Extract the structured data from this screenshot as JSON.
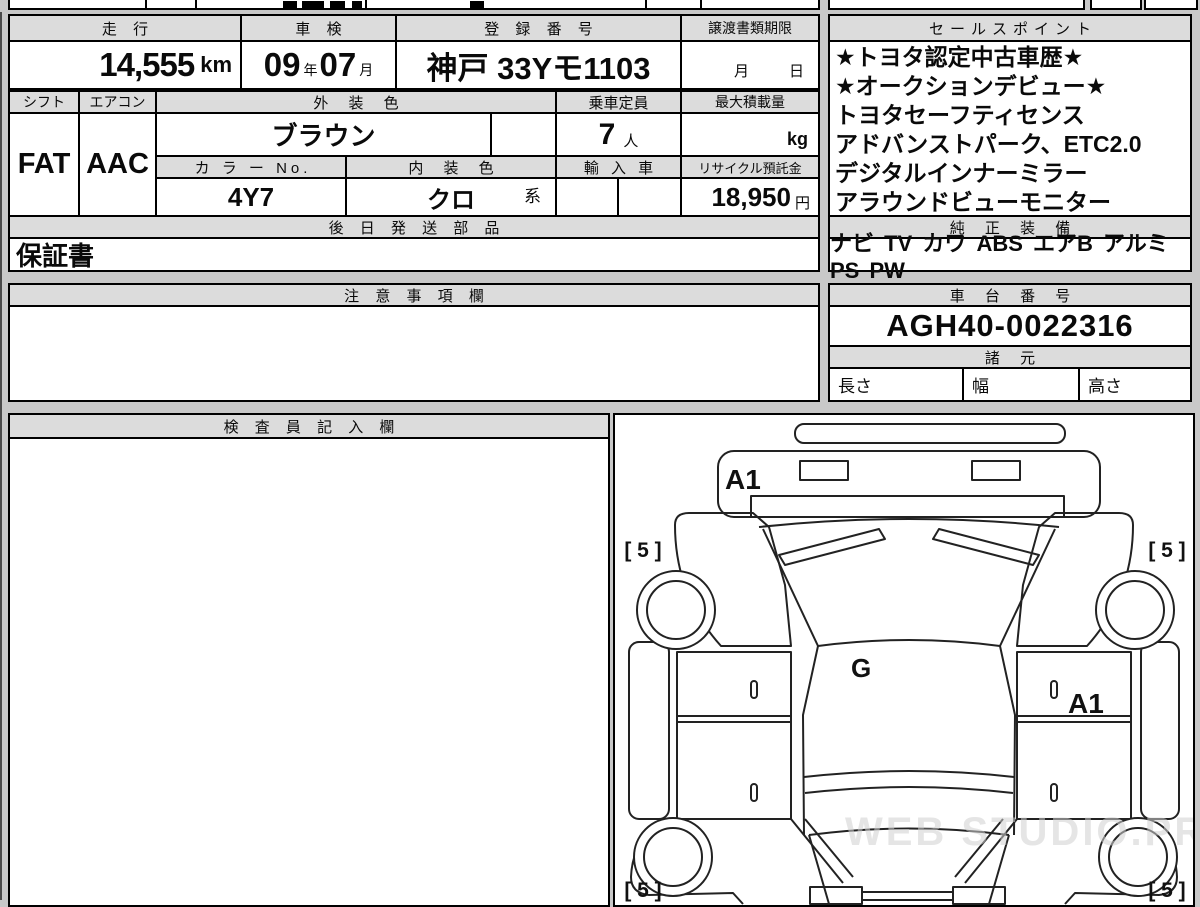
{
  "top_table": {
    "mileage": {
      "header": "走 行",
      "value": "14,555",
      "unit": "km"
    },
    "inspection": {
      "header": "車 検",
      "year": "09",
      "year_unit": "年",
      "month": "07",
      "month_unit": "月"
    },
    "registration": {
      "header": "登 録 番 号",
      "value": "神戸 33Yモ1103"
    },
    "transfer_deadline": {
      "header": "譲渡書類期限",
      "month_label": "月",
      "day_label": "日"
    }
  },
  "spec_table": {
    "shift": {
      "header": "シフト",
      "value": "FAT"
    },
    "aircon": {
      "header": "エアコン",
      "value": "AAC"
    },
    "exterior_color": {
      "header": "外 装 色",
      "value": "ブラウン"
    },
    "capacity": {
      "header": "乗車定員",
      "value": "7",
      "unit": "人"
    },
    "max_load": {
      "header": "最大積載量",
      "unit": "kg"
    },
    "color_no": {
      "header": "カ ラ ー No.",
      "value": "4Y7"
    },
    "interior_color": {
      "header": "内 装 色",
      "value": "クロ",
      "suffix": "系"
    },
    "import_car": {
      "header": "輸 入 車"
    },
    "recycle": {
      "header": "リサイクル預託金",
      "value": "18,950",
      "unit": "円"
    }
  },
  "later_parts": {
    "header": "後 日 発 送 部 品",
    "value": "保証書"
  },
  "sales_points": {
    "header": "セールスポイント",
    "items": [
      "★トヨタ認定中古車歴★",
      "★オークションデビュー★",
      "トヨタセーフティセンス",
      "アドバンストパーク、ETC2.0",
      "デジタルインナーミラー",
      "アラウンドビューモニター"
    ]
  },
  "equipment": {
    "header": "純 正 装 備",
    "value": "ナビ TV カワ ABS エアB アルミ PS PW"
  },
  "notes": {
    "header": "注 意 事 項 欄"
  },
  "chassis": {
    "header": "車 台 番 号",
    "value": "AGH40-0022316"
  },
  "specs": {
    "header": "諸 元",
    "length_label": "長さ",
    "width_label": "幅",
    "height_label": "高さ"
  },
  "inspector": {
    "header": "検 査 員 記 入 欄"
  },
  "diagram": {
    "front_label": "A1",
    "roof_label": "G",
    "side_label": "A1",
    "corner_mark": "[ 5 ]",
    "watermark": "WEB STUDIO.PRO"
  }
}
